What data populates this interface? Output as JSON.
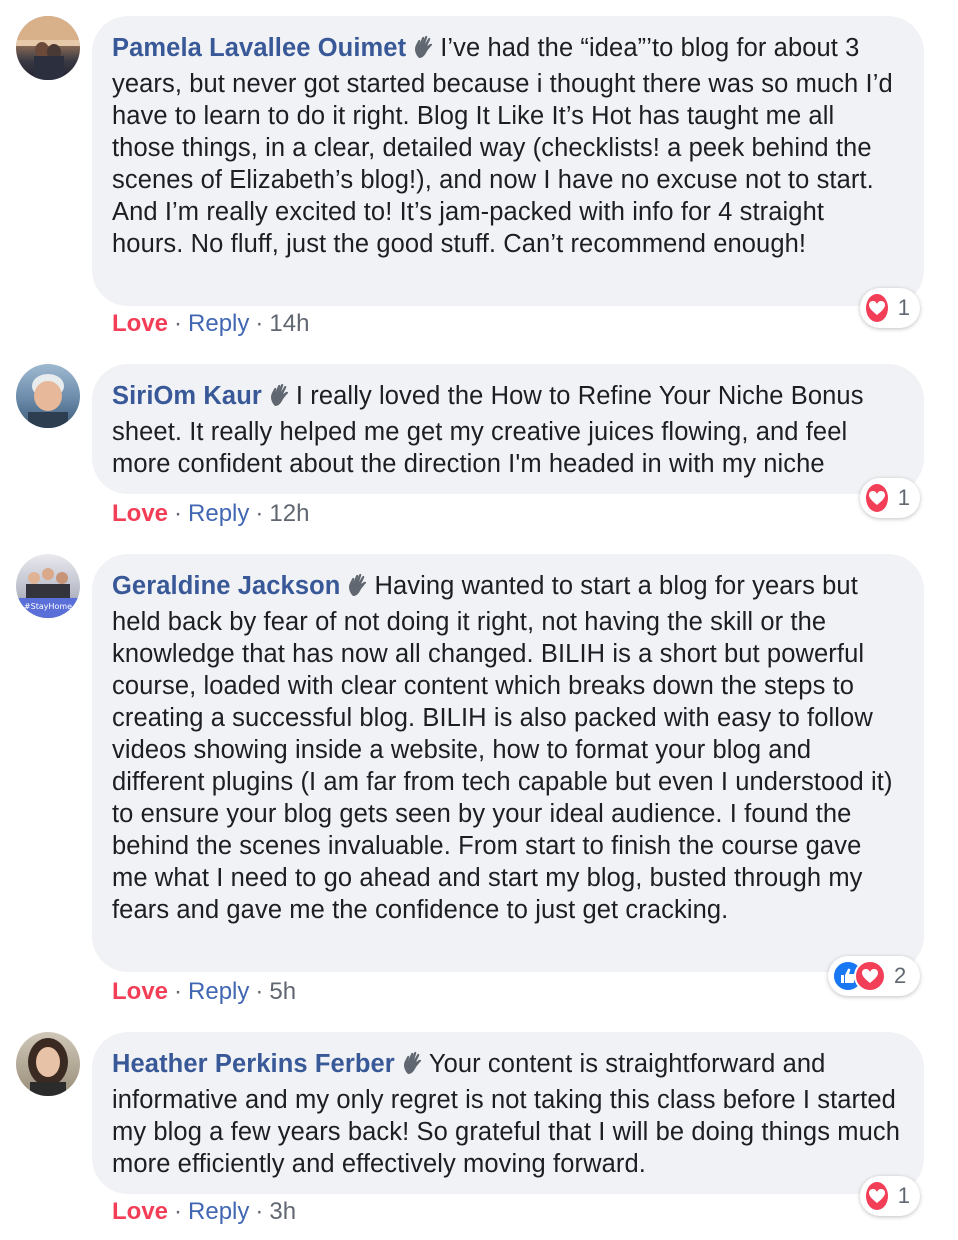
{
  "comments": [
    {
      "author": "Pamela Lavallee Ouimet",
      "text": "I’ve had the “idea”’to blog for about 3 years, but never got started because i thought there was so much I’d have to learn to do it right. Blog It Like It’s Hot has taught me all those things, in a clear, detailed way (checklists! a peek behind the scenes of Elizabeth’s blog!), and now I have no excuse not to start. And I’m really excited to! It’s jam-packed with info for 4 straight hours. No fluff, just the good stuff. Can’t recommend enough!",
      "love_label": "Love",
      "reply_label": "Reply",
      "time": "14h",
      "reactions": [
        "love-icon"
      ],
      "reaction_count": "1"
    },
    {
      "author": "SiriOm Kaur",
      "text": "I really loved the How to Refine Your Niche Bonus sheet. It really helped me get my creative juices flowing, and feel more confident about the direction I'm headed in with my niche",
      "love_label": "Love",
      "reply_label": "Reply",
      "time": "12h",
      "reactions": [
        "love-icon"
      ],
      "reaction_count": "1"
    },
    {
      "author": "Geraldine Jackson",
      "text": "Having wanted to start a blog for years but held back by fear of not doing it right, not having the skill or the knowledge that has now all changed. BILIH is a short but powerful course, loaded with clear content which breaks down the steps to creating a successful blog. BILIH is also packed with easy to follow videos showing inside a website, how to format your blog and different plugins (I am far from tech capable but even I understood it) to ensure your blog gets seen by your ideal audience. I found the behind the scenes invaluable. From start to finish the course gave me what I need to go ahead and start my blog, busted through my fears and gave me the confidence to just get cracking.",
      "love_label": "Love",
      "reply_label": "Reply",
      "time": "5h",
      "reactions": [
        "like-icon",
        "love-icon"
      ],
      "reaction_count": "2",
      "avatar_badge": "#StayHome"
    },
    {
      "author": "Heather Perkins Ferber",
      "text": "Your content is straightforward and informative and my only regret is not taking this class before I started my blog a few years back! So grateful that I will be doing things much more efficiently and effectively moving forward.",
      "love_label": "Love",
      "reply_label": "Reply",
      "time": "3h",
      "reactions": [
        "love-icon"
      ],
      "reaction_count": "1"
    }
  ],
  "separator": "·",
  "colors": {
    "author": "#385898",
    "love": "#f33e58",
    "reply": "#4267b2",
    "bubble": "#f0f2f5",
    "like": "#1877f2"
  }
}
